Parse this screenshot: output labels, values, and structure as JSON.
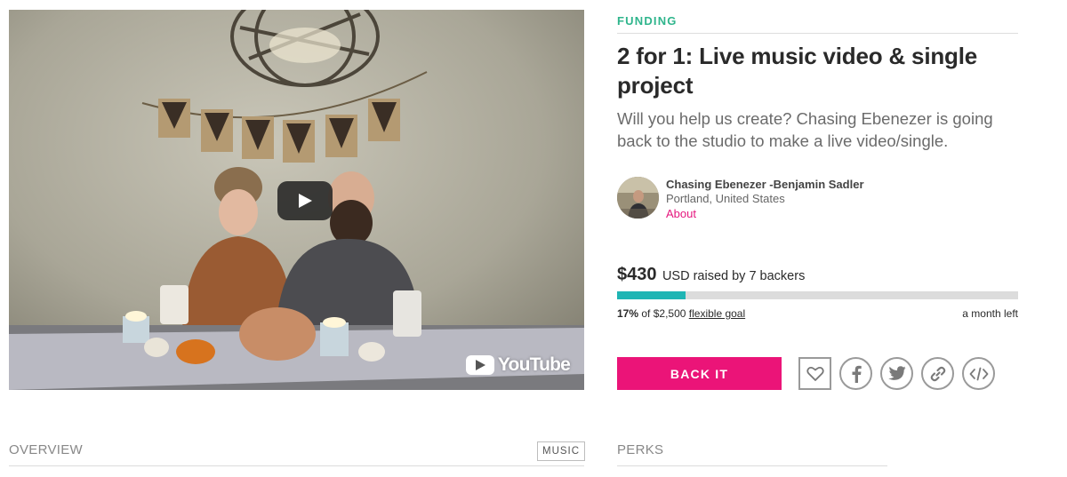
{
  "video": {
    "provider": "YouTube",
    "play_icon": "play-icon"
  },
  "campaign": {
    "category": "FUNDING",
    "title": "2 for 1: Live music video & single project",
    "tagline": "Will you help us create? Chasing Ebenezer is going back to the studio to make a live video/single."
  },
  "owner": {
    "name": "Chasing Ebenezer -Benjamin Sadler",
    "location": "Portland, United States",
    "about_label": "About"
  },
  "funding": {
    "amount": "$430",
    "raised_text": "USD raised by 7 backers",
    "percent_label": "17%",
    "goal_text": "of $2,500",
    "goal_type_label": "flexible goal",
    "time_left": "a month left",
    "progress_fraction": 0.17
  },
  "actions": {
    "back_label": "BACK IT",
    "follow_icon": "heart-icon",
    "share_icons": [
      "facebook-icon",
      "twitter-icon",
      "link-icon",
      "embed-code-icon"
    ]
  },
  "tabs": {
    "overview_label": "OVERVIEW",
    "tag_label": "MUSIC",
    "perks_label": "PERKS"
  },
  "colors": {
    "accent_pink": "#eb1478",
    "category_green": "#2fb58c",
    "progress_teal": "#1fb5b4"
  }
}
